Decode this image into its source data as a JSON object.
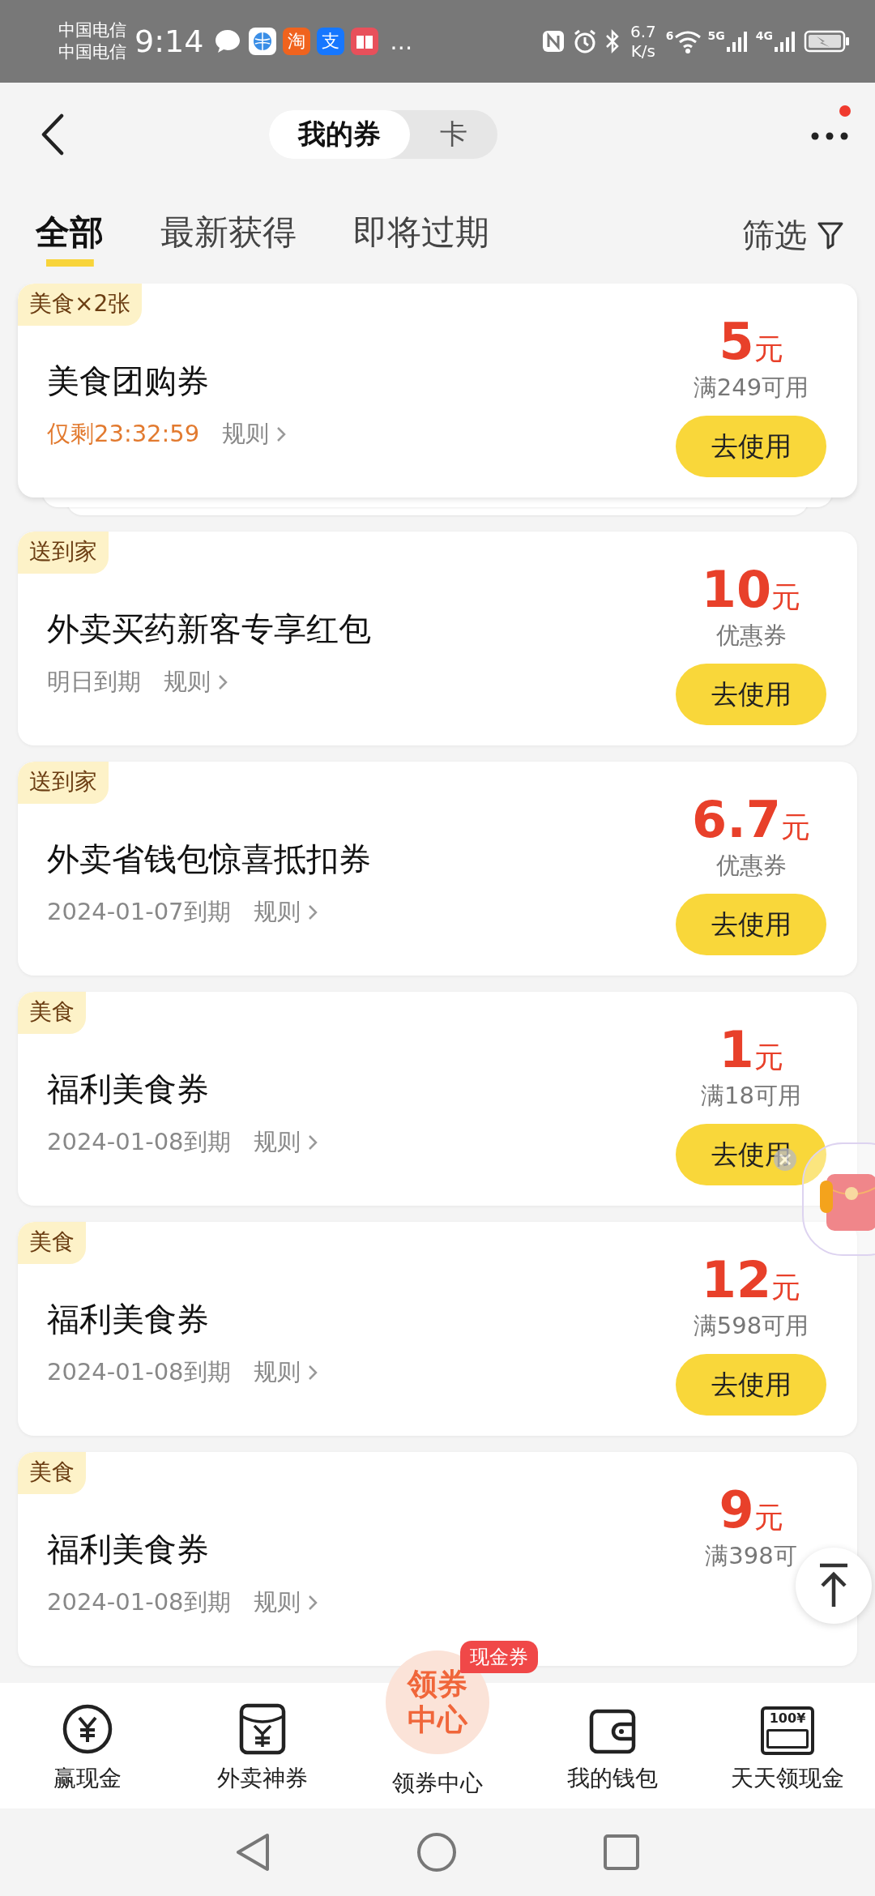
{
  "status_bar": {
    "carriers": [
      "中国电信",
      "中国电信"
    ],
    "time": "9:14",
    "app_icons": [
      {
        "kind": "chat"
      },
      {
        "kind": "browser"
      },
      {
        "kind": "char",
        "text": "淘",
        "color": "#f0631e"
      },
      {
        "kind": "char",
        "text": "支",
        "color": "#1677ff"
      },
      {
        "kind": "book"
      }
    ],
    "more": "…",
    "speed": [
      "6.7",
      "K/s"
    ],
    "wifi_badge": "6",
    "networks": [
      "5G",
      "4G"
    ]
  },
  "header": {
    "segments": [
      {
        "label": "我的券",
        "selected": true
      },
      {
        "label": "卡",
        "selected": false
      }
    ],
    "has_notification": true
  },
  "tabs": [
    {
      "label": "全部",
      "selected": true
    },
    {
      "label": "最新获得",
      "selected": false
    },
    {
      "label": "即将过期",
      "selected": false
    }
  ],
  "filter": "筛选",
  "coupons": [
    {
      "tag": "美食×2张",
      "title": "美食团购券",
      "expiry": "仅剩23:32:59",
      "urgent": true,
      "rule": "规则",
      "amount": "5",
      "unit": "元",
      "note": "满249可用",
      "button": "去使用",
      "stacked": true
    },
    {
      "tag": "送到家",
      "title": "外卖买药新客专享红包",
      "expiry": "明日到期",
      "urgent": false,
      "rule": "规则",
      "amount": "10",
      "unit": "元",
      "note": "优惠券",
      "button": "去使用",
      "stacked": false
    },
    {
      "tag": "送到家",
      "title": "外卖省钱包惊喜抵扣券",
      "expiry": "2024-01-07到期",
      "urgent": false,
      "rule": "规则",
      "amount": "6.7",
      "unit": "元",
      "note": "优惠券",
      "button": "去使用",
      "stacked": false
    },
    {
      "tag": "美食",
      "title": "福利美食券",
      "expiry": "2024-01-08到期",
      "urgent": false,
      "rule": "规则",
      "amount": "1",
      "unit": "元",
      "note": "满18可用",
      "button": "去使用",
      "stacked": false
    },
    {
      "tag": "美食",
      "title": "福利美食券",
      "expiry": "2024-01-08到期",
      "urgent": false,
      "rule": "规则",
      "amount": "12",
      "unit": "元",
      "note": "满598可用",
      "button": "去使用",
      "stacked": false
    },
    {
      "tag": "美食",
      "title": "福利美食券",
      "expiry": "2024-01-08到期",
      "urgent": false,
      "rule": "规则",
      "amount": "9",
      "unit": "元",
      "note": "满398可",
      "stacked": false
    }
  ],
  "bottom_nav": [
    {
      "kind": "yuan-circle",
      "label": "赢现金"
    },
    {
      "kind": "envelope",
      "label": "外卖神券"
    },
    {
      "kind": "center",
      "label": "领券中心",
      "emblem": [
        "领券",
        "中心"
      ],
      "badge": "现金券"
    },
    {
      "kind": "wallet",
      "label": "我的钱包"
    },
    {
      "kind": "cash",
      "label": "天天领现金",
      "icon_text": "100¥"
    }
  ]
}
